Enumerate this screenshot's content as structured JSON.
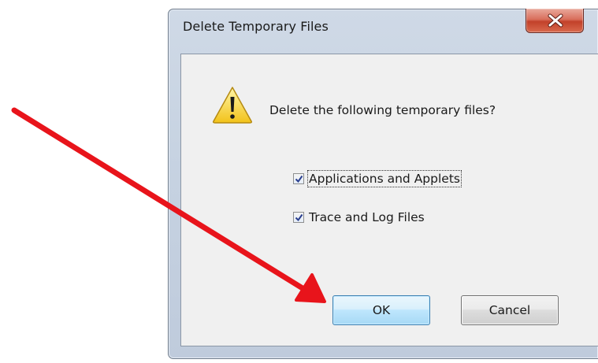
{
  "dialog": {
    "title": "Delete Temporary Files",
    "close_icon": "close-icon",
    "warning_icon": "warning-icon",
    "message": "Delete the following temporary files?",
    "options": [
      {
        "label": "Applications and Applets",
        "checked": true
      },
      {
        "label": "Trace and Log Files",
        "checked": true
      }
    ],
    "ok_label": "OK",
    "cancel_label": "Cancel"
  },
  "annotation": {
    "color": "#e8141b",
    "icon": "red-arrow"
  }
}
